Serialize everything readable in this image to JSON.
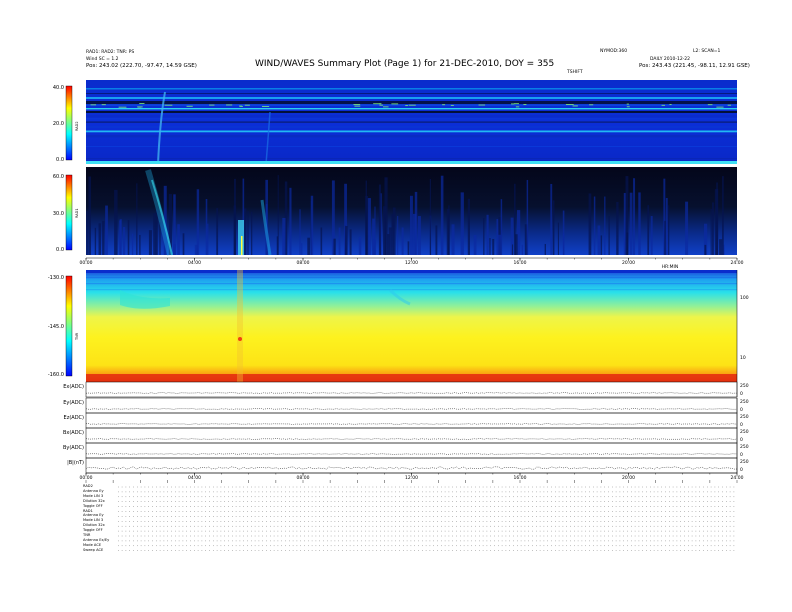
{
  "header": {
    "title": "WIND/WAVES Summary Plot (Page 1) for 21-DEC-2010, DOY = 355",
    "left_line1": "RAD1: RAD2: TNR: PS",
    "left_line2": "Wind SC = 1.2",
    "left_line3": "Pos: 243.02 (222.70, -97.47, 14.59 GSE)",
    "center_right": "NYMOD:360",
    "right_line1": "L2: SCAN=1",
    "right_line2": "DAILY 2010-12-22",
    "right_line3": "Pos: 243.43 (221.45, -98.11, 12.91 GSE)",
    "subtitle_right": "TSHIFT"
  },
  "panels": {
    "rad2": {
      "label": "RAD2"
    },
    "rad1": {
      "label": "RAD1"
    },
    "tnr": {
      "label": "TNR"
    },
    "lines": [
      {
        "label": "Ex(ADC)"
      },
      {
        "label": "Ey(ADC)"
      },
      {
        "label": "Ez(ADC)"
      },
      {
        "label": "Bx(ADC)"
      },
      {
        "label": "By(ADC)"
      },
      {
        "label": "|B|(nT)"
      }
    ]
  },
  "time_axis_label": "HR:MIN",
  "footer": {
    "col1": [
      "RAD2",
      "Antenna Ey",
      "Mode LIN 3",
      "Dilution 32x",
      "Toggle OFF",
      "RAD1",
      "Antenna Ey",
      "Mode LIN 3",
      "Dilution 32x",
      "Toggle OFF",
      "TNR",
      "Antenna Ex/Ey",
      "Mode ACE",
      "Sweep ACE"
    ]
  },
  "chart_data": [
    {
      "type": "heatmap",
      "name": "RAD2",
      "x_ticks": [
        "00:00",
        "04:00",
        "08:00",
        "12:00",
        "16:00",
        "20:00",
        "24:00"
      ],
      "xlim": [
        0,
        24
      ],
      "ylim": [
        0,
        40
      ],
      "y_ticks": [
        "40.0",
        "20.0",
        "0.0"
      ],
      "colorbar": [
        "#0000ff",
        "#00ffff",
        "#ffff00",
        "#ff0000"
      ]
    },
    {
      "type": "heatmap",
      "name": "RAD1",
      "x_ticks": [
        "00:00",
        "04:00",
        "08:00",
        "12:00",
        "16:00",
        "20:00",
        "24:00"
      ],
      "xlim": [
        0,
        24
      ],
      "ylim": [
        0,
        60
      ],
      "y_ticks": [
        "60.0",
        "30.0",
        "0.0"
      ],
      "colorbar": [
        "#0000ff",
        "#00ffff",
        "#ffff00",
        "#ff0000"
      ]
    },
    {
      "type": "heatmap",
      "name": "TNR",
      "x_ticks": [
        "00:00",
        "04:00",
        "08:00",
        "12:00",
        "16:00",
        "20:00",
        "24:00"
      ],
      "xlim": [
        0,
        24
      ],
      "y_ticks": [
        "-130.0",
        "-145.0",
        "-160.0"
      ],
      "ylim": [
        -160,
        -130
      ],
      "right_ticks": [
        "100",
        "10"
      ],
      "colorbar": [
        "#ff0000",
        "#ffff00",
        "#00ffff",
        "#0000ff"
      ]
    },
    {
      "type": "line",
      "name": "Ex(ADC)",
      "x_ticks": [
        "00:00",
        "04:00",
        "08:00",
        "12:00",
        "16:00",
        "20:00",
        "24:00"
      ],
      "right_ticks": [
        "250",
        "0"
      ]
    }
  ]
}
